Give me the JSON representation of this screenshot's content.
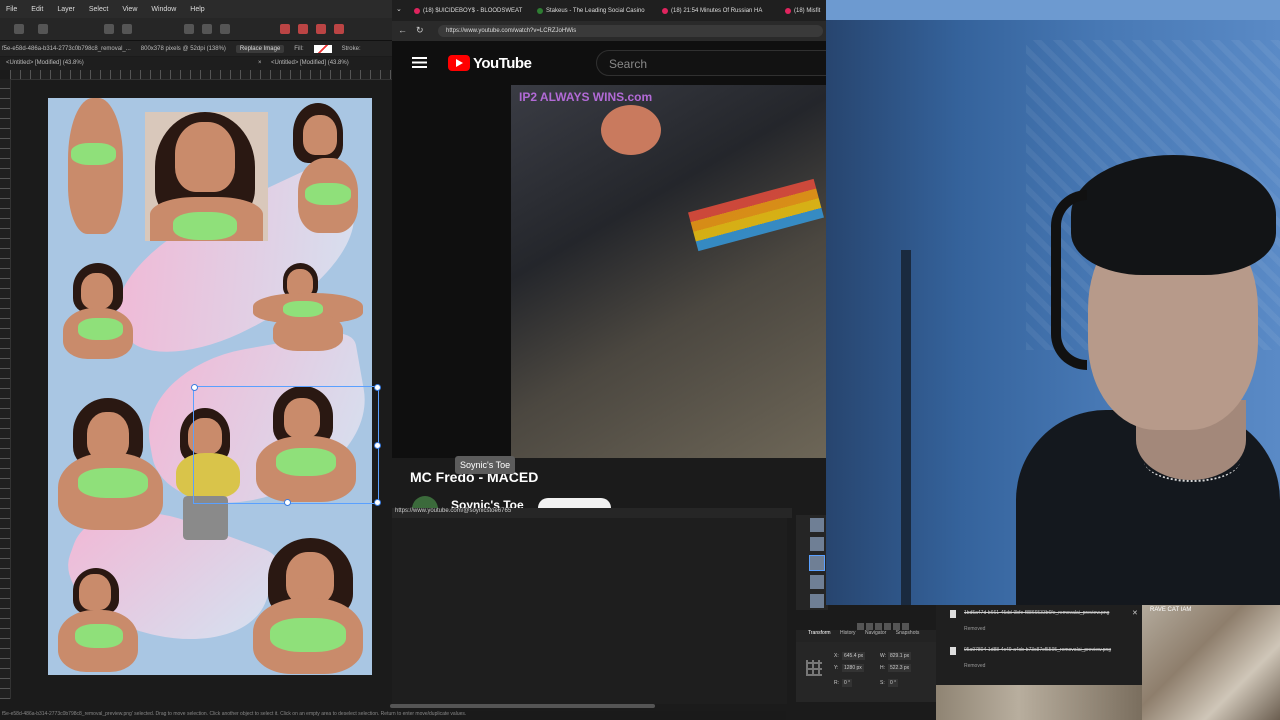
{
  "editor": {
    "menu": [
      "File",
      "Edit",
      "Layer",
      "Select",
      "View",
      "Window",
      "Help"
    ],
    "context": {
      "file_info": "f5e-e58d-486a-b314-2773c0b798c8_removal_...",
      "dimensions": "800x378 pixels @ 52dpi (138%)",
      "replace_image": "Replace Image",
      "fill_label": "Fill:",
      "stroke_label": "Stroke:"
    },
    "doc_tabs": [
      "<Untitled> [Modified] (43.8%)",
      "<Untitled> [Modified] (43.8%)"
    ],
    "doc_tab_close": "×",
    "status_text": "f5e-e58d-486a-b314-2773c0b798c8_removal_preview.png' selected. Drag to move selection. Click another object to select it. Click on an empty area to deselect selection. Return to enter move/duplicate values."
  },
  "browser": {
    "tabs": [
      {
        "label": "(18) $UICIDEBOY$ - BLOODSWEAT"
      },
      {
        "label": "Stakeus - The Leading Social Casino"
      },
      {
        "label": "(18) 21:54 Minutes Of Russian HA"
      },
      {
        "label": "(18) Misfit"
      }
    ],
    "url": "https://www.youtube.com/watch?v=LCRZJoHWis",
    "youtube": {
      "logo_text": "YouTube",
      "search_placeholder": "Search",
      "video_watermark": "IP2 ALWAYS WINS.com",
      "tooltip": "Soynic's Toe",
      "title": "MC Fredo - MACED",
      "channel": "Soynic's Toe"
    },
    "status_url": "https://www.youtube.com/@soynicstoe6765"
  },
  "panels": {
    "tabs": [
      "Transform",
      "History",
      "Navigator",
      "Snapshots"
    ],
    "transform": {
      "x_label": "X:",
      "x_value": "645.4 px",
      "y_label": "Y:",
      "y_value": "1280 px",
      "w_label": "W:",
      "w_value": "829.1 px",
      "h_label": "H:",
      "h_value": "522.3 px",
      "r_label": "R:",
      "r_value": "0 °",
      "s_label": "S:",
      "s_value": "0 °"
    }
  },
  "downloads": {
    "items": [
      {
        "name": "1bd5a47d-b661-45dd-9bfe-f8866533b6fe_removalai_preview.png",
        "status": "Removed"
      },
      {
        "name": "95a97804-1d88-4c49-a4cb-b73c87cf5595_removalai_preview.png",
        "status": "Removed"
      }
    ]
  },
  "stream": {
    "overlay_tag": "RAVE CAT IAM"
  },
  "colors": {
    "youtube_red": "#ff0000",
    "selection_blue": "#5aa0ff",
    "canvas_bg": "#a9c6e3"
  }
}
